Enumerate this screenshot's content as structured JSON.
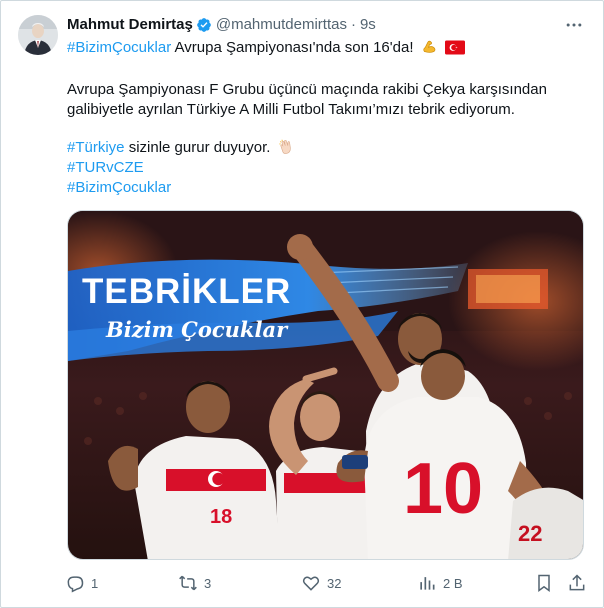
{
  "author": {
    "name": "Mahmut Demirtaş",
    "handle": "@mahmutdemirttas",
    "separator": "·",
    "time": "9s"
  },
  "post": {
    "line1_hashtag": "#BizimÇocuklar",
    "line1_text": " Avrupa Şampiyonası'nda son 16'da!",
    "line1_emojis": [
      "flexed-biceps",
      "turkey-flag"
    ],
    "para1_line1": "Avrupa Şampiyonası F Grubu üçüncü maçında rakibi Çekya karşısından",
    "para1_line2": "galibiyetle ayrılan Türkiye A Milli Futbol Takımı’mızı tebrik ediyorum.",
    "para2_hashtag": "#Türkiye",
    "para2_text": " sizinle gurur duyuyor.",
    "para2_emoji": "clapping-hands",
    "hashtag2": "#TURvCZE",
    "hashtag3": "#BizimÇocuklar"
  },
  "media": {
    "headline": "TEBRİKLER",
    "subline": "Bizim Çocuklar",
    "jersey_number_main": "10",
    "jersey_number_left": "18",
    "jersey_number_right": "22"
  },
  "actions": {
    "replies": "1",
    "reposts": "3",
    "likes": "32",
    "views": "2 B"
  },
  "colors": {
    "link": "#1d9bf0",
    "verified": "#1d9bf0",
    "muted": "#536471",
    "turkey_red": "#e30a17"
  }
}
